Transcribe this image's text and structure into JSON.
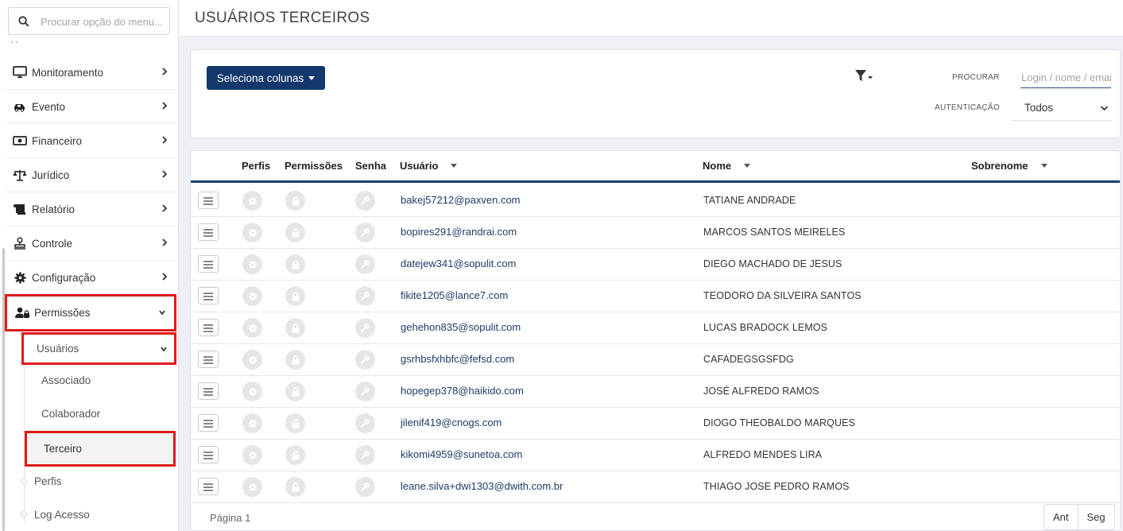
{
  "sidebar": {
    "search_placeholder": "Procurar opção do menu...",
    "items": [
      {
        "label": "Monitoramento"
      },
      {
        "label": "Evento"
      },
      {
        "label": "Financeiro"
      },
      {
        "label": "Jurídico"
      },
      {
        "label": "Relatório"
      },
      {
        "label": "Controle"
      },
      {
        "label": "Configuração"
      },
      {
        "label": "Permissões"
      }
    ],
    "sub_items": [
      {
        "label": "Usuários"
      },
      {
        "label": "Associado"
      },
      {
        "label": "Colaborador"
      },
      {
        "label": "Terceiro"
      },
      {
        "label": "Perfis"
      },
      {
        "label": "Log Acesso"
      }
    ]
  },
  "header": {
    "title": "USUÁRIOS TERCEIROS"
  },
  "filters": {
    "columns_button": "Seleciona colunas",
    "search_label": "PROCURAR",
    "search_placeholder": "Login / nome / email",
    "auth_label": "AUTENTICAÇÃO",
    "auth_value": "Todos"
  },
  "table": {
    "columns": [
      "Perfis",
      "Permissões",
      "Senha",
      "Usuário",
      "Nome",
      "Sobrenome"
    ],
    "rows": [
      {
        "user": "bakej57212@paxven.com",
        "name": "TATIANE ANDRADE"
      },
      {
        "user": "bopires291@randrai.com",
        "name": "MARCOS SANTOS MEIRELES"
      },
      {
        "user": "datejew341@sopulit.com",
        "name": "DIEGO MACHADO DE JESUS"
      },
      {
        "user": "fikite1205@lance7.com",
        "name": "TEODORO DA SILVEIRA SANTOS"
      },
      {
        "user": "gehehon835@sopulit.com",
        "name": "LUCAS BRADOCK LEMOS"
      },
      {
        "user": "gsrhbsfxhbfc@fefsd.com",
        "name": "CAFADEGSGSFDG"
      },
      {
        "user": "hopegep378@haikido.com",
        "name": "JOSÉ ALFREDO RAMOS"
      },
      {
        "user": "jilenif419@cnogs.com",
        "name": "DIOGO THEOBALDO MARQUES"
      },
      {
        "user": "kikomi4959@sunetoa.com",
        "name": "ALFREDO MENDES LIRA"
      },
      {
        "user": "leane.silva+dwi1303@dwith.com.br",
        "name": "THIAGO JOSE PEDRO RAMOS"
      }
    ]
  },
  "pagination": {
    "page_text": "Página 1",
    "prev": "Ant",
    "next": "Seg"
  },
  "colors": {
    "primary": "#13386b",
    "highlight": "#e01b1b"
  }
}
